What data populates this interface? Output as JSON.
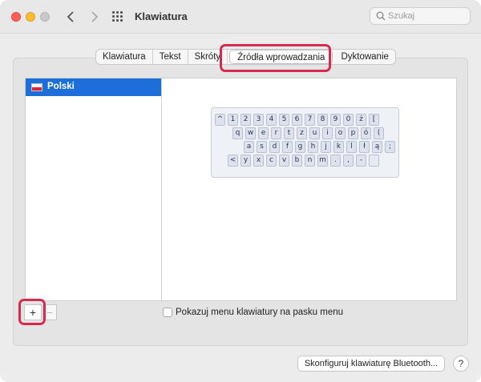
{
  "window": {
    "title": "Klawiatura"
  },
  "search": {
    "placeholder": "Szukaj"
  },
  "tabs": [
    {
      "label": "Klawiatura"
    },
    {
      "label": "Tekst"
    },
    {
      "label": "Skróty"
    },
    {
      "label": "Źródła wprowadzania",
      "active": true
    },
    {
      "label": "Dyktowanie"
    }
  ],
  "input_sources": [
    {
      "label": "Polski",
      "flag": "poland-flag-icon",
      "selected": true
    }
  ],
  "keyboard_preview": {
    "rows": [
      [
        "^",
        "1",
        "2",
        "3",
        "4",
        "5",
        "6",
        "7",
        "8",
        "9",
        "0",
        "ż",
        "["
      ],
      [
        "q",
        "w",
        "e",
        "r",
        "t",
        "z",
        "u",
        "i",
        "o",
        "p",
        "ó",
        "("
      ],
      [
        "a",
        "s",
        "d",
        "f",
        "g",
        "h",
        "j",
        "k",
        "l",
        "ł",
        "ą",
        ";"
      ],
      [
        "<",
        "y",
        "x",
        "c",
        "v",
        "b",
        "n",
        "m",
        ".",
        ",",
        "-"
      ]
    ]
  },
  "controls": {
    "add_label": "+",
    "remove_label": "−",
    "show_menu_label": "Pokazuj menu klawiatury na pasku menu",
    "show_menu_checked": false,
    "bluetooth_button": "Skonfiguruj klawiaturę Bluetooth...",
    "help_label": "?"
  },
  "colors": {
    "highlight": "#d62b4f",
    "selection": "#1c6fd8"
  }
}
